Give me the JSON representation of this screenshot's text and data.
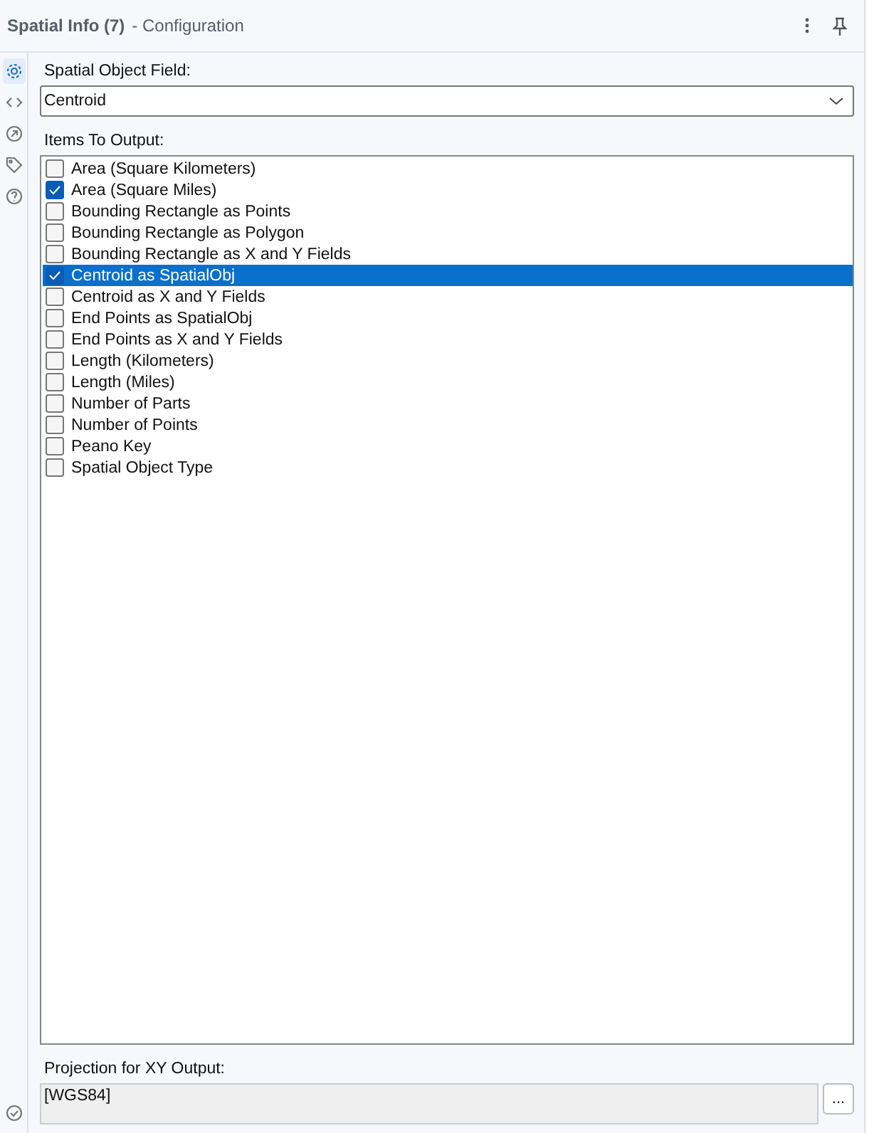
{
  "header": {
    "title": "Spatial Info (7)",
    "subtitle": "- Configuration"
  },
  "sidebar": {
    "items": [
      {
        "kind": "gear",
        "selected": true
      },
      {
        "kind": "code",
        "selected": false
      },
      {
        "kind": "arrow",
        "selected": false
      },
      {
        "kind": "tag",
        "selected": false
      },
      {
        "kind": "help",
        "selected": false
      }
    ]
  },
  "spatial_object_field": {
    "label": "Spatial Object Field:",
    "value": "Centroid"
  },
  "items_to_output": {
    "label": "Items To Output:",
    "items": [
      {
        "label": "Area (Square Kilometers)",
        "checked": false,
        "selected": false
      },
      {
        "label": "Area (Square Miles)",
        "checked": true,
        "selected": false
      },
      {
        "label": "Bounding Rectangle as Points",
        "checked": false,
        "selected": false
      },
      {
        "label": "Bounding Rectangle as Polygon",
        "checked": false,
        "selected": false
      },
      {
        "label": "Bounding Rectangle as X and Y Fields",
        "checked": false,
        "selected": false
      },
      {
        "label": "Centroid as SpatialObj",
        "checked": true,
        "selected": true
      },
      {
        "label": "Centroid as X and Y Fields",
        "checked": false,
        "selected": false
      },
      {
        "label": "End Points as SpatialObj",
        "checked": false,
        "selected": false
      },
      {
        "label": "End Points as X and Y Fields",
        "checked": false,
        "selected": false
      },
      {
        "label": "Length (Kilometers)",
        "checked": false,
        "selected": false
      },
      {
        "label": "Length (Miles)",
        "checked": false,
        "selected": false
      },
      {
        "label": "Number of Parts",
        "checked": false,
        "selected": false
      },
      {
        "label": "Number of Points",
        "checked": false,
        "selected": false
      },
      {
        "label": "Peano Key",
        "checked": false,
        "selected": false
      },
      {
        "label": "Spatial Object Type",
        "checked": false,
        "selected": false
      }
    ]
  },
  "projection": {
    "label": "Projection for XY Output:",
    "value": "[WGS84]",
    "button": "..."
  }
}
